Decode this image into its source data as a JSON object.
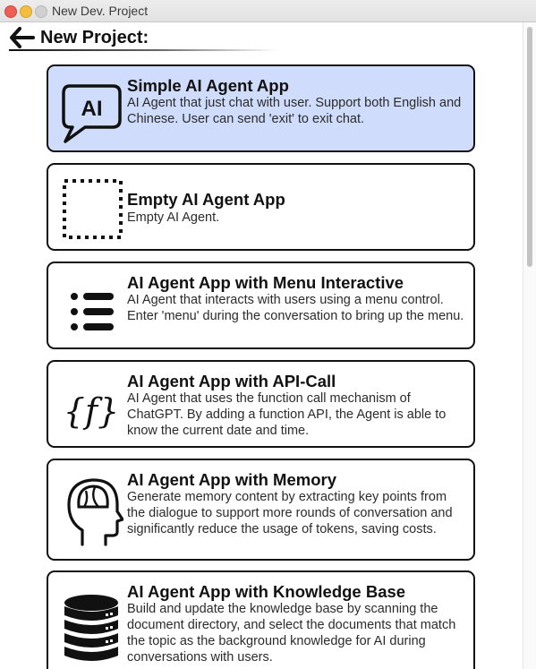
{
  "window": {
    "title": "New Dev. Project"
  },
  "header": {
    "title": "New Project:"
  },
  "cards": [
    {
      "title": "Simple AI Agent App",
      "description": "AI Agent that just chat with user. Support both English and Chinese. User can send 'exit' to exit chat.",
      "icon": "ai-chat-bubble-icon",
      "icon_text": "AI",
      "selected": true
    },
    {
      "title": "Empty AI Agent App",
      "description": "Empty AI Agent.",
      "icon": "dotted-square-icon",
      "selected": false
    },
    {
      "title": "AI Agent App with Menu Interactive",
      "description": "AI Agent that interacts with users using a menu control. Enter 'menu' during the conversation to bring up the menu.",
      "icon": "list-menu-icon",
      "selected": false
    },
    {
      "title": "AI Agent App with API-Call",
      "description": "AI Agent that uses the function call mechanism of ChatGPT. By adding a function API, the Agent is able to know the current date and time.",
      "icon": "function-braces-icon",
      "icon_text": "{f}",
      "selected": false
    },
    {
      "title": "AI Agent App with Memory",
      "description": "Generate memory content by extracting key points from the dialogue to support more rounds of conversation and significantly reduce the usage of tokens, saving costs.",
      "icon": "head-brain-icon",
      "selected": false
    },
    {
      "title": "AI Agent App with Knowledge Base",
      "description": "Build and update the knowledge base by scanning the document directory, and select the documents that match the topic as the background knowledge for AI during conversations with users.",
      "icon": "database-icon",
      "selected": false
    }
  ],
  "colors": {
    "selected_card_bg": "#cfdcfb",
    "card_border": "#111111",
    "close": "#ec5f55",
    "minimize": "#f4be3f",
    "zoom_disabled": "#d0d0d0"
  }
}
